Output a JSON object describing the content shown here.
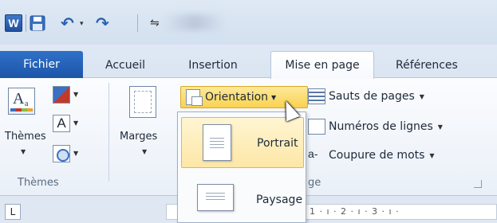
{
  "quick_access": {
    "app_icon_text": "W",
    "undo_dropdown": "▾",
    "customize": "⇋"
  },
  "tabs": [
    {
      "label": "Fichier"
    },
    {
      "label": "Accueil"
    },
    {
      "label": "Insertion"
    },
    {
      "label": "Mise en page"
    },
    {
      "label": "Références"
    }
  ],
  "ribbon": {
    "themes": {
      "label": "Thèmes",
      "group_label": "Thèmes",
      "icon_letter": "A",
      "icon_sub": "a"
    },
    "fonts_icon_text": "A",
    "marges": {
      "label": "Marges"
    },
    "orientation": {
      "label": "Orientation"
    },
    "breaks": {
      "label": "Sauts de pages"
    },
    "line_numbers": {
      "label": "Numéros de lignes"
    },
    "hyphenation": {
      "label": "Coupure de mots",
      "icon_text": "a-"
    },
    "group_label_partial": "ge"
  },
  "orientation_menu": {
    "items": [
      {
        "label": "Portrait",
        "selected": true
      },
      {
        "label": "Paysage",
        "selected": false
      }
    ]
  },
  "ruler": {
    "corner": "L",
    "text": "· 1 · ı · 2 · ı · 3 · ı ·"
  },
  "colors": {
    "file_tab": "#2f71c8",
    "highlight": "#f9d24f",
    "selected_item": "#fde7a6"
  }
}
